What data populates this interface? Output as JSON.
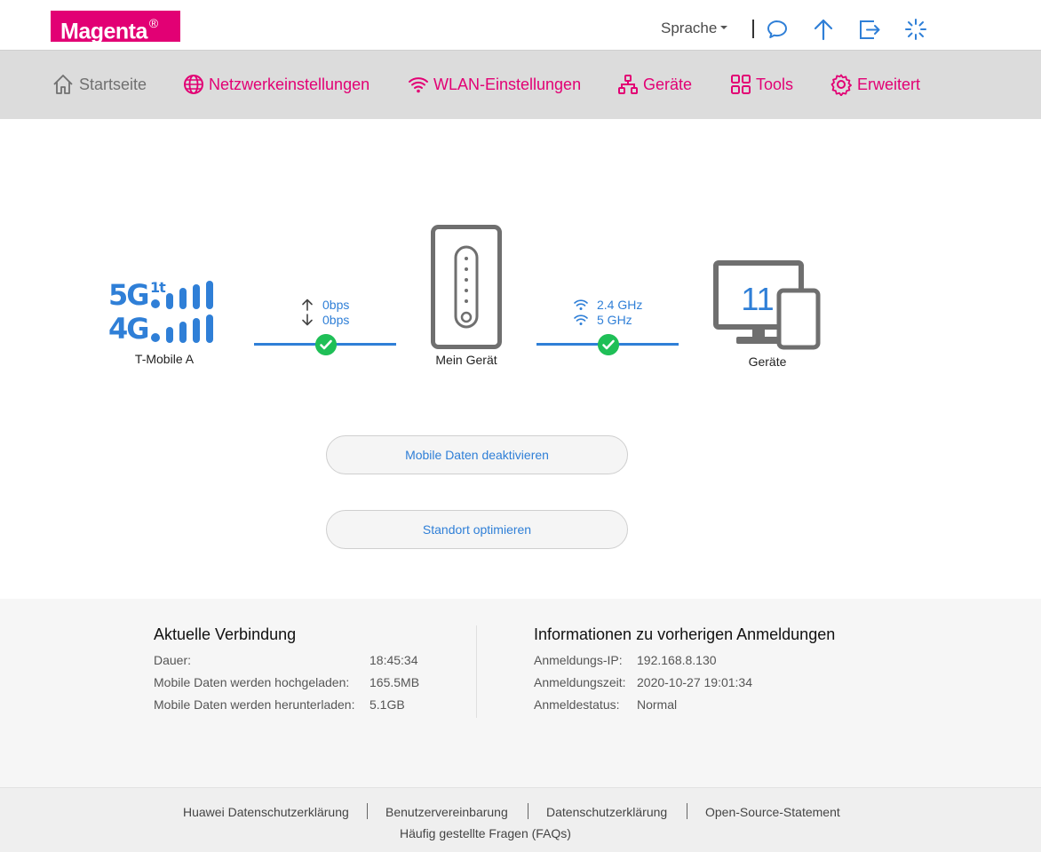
{
  "header": {
    "logo_text": "Magenta",
    "logo_mark": "®",
    "language_label": "Sprache",
    "icons": [
      "chat-icon",
      "upload-icon",
      "logout-icon",
      "loading-icon"
    ]
  },
  "nav": {
    "items": [
      {
        "label": "Startseite",
        "icon": "home-icon"
      },
      {
        "label": "Netzwerkeinstellungen",
        "icon": "globe-icon"
      },
      {
        "label": "WLAN-Einstellungen",
        "icon": "wifi-icon"
      },
      {
        "label": "Geräte",
        "icon": "network-tree-icon"
      },
      {
        "label": "Tools",
        "icon": "grid-icon"
      },
      {
        "label": "Erweitert",
        "icon": "gear-icon"
      }
    ]
  },
  "diagram": {
    "network": {
      "badge_top": "5G",
      "badge_top_sup": "1t",
      "badge_bottom": "4G",
      "provider": "T-Mobile A"
    },
    "traffic": {
      "upload": "0bps",
      "download": "0bps"
    },
    "router_label": "Mein Gerät",
    "wifi": {
      "band1": "2.4 GHz",
      "band2": "5 GHz"
    },
    "devices": {
      "count": "11",
      "label": "Geräte"
    }
  },
  "actions": {
    "disable_mobile_data": "Mobile Daten deaktivieren",
    "optimize_location": "Standort optimieren"
  },
  "current_connection": {
    "title": "Aktuelle Verbindung",
    "rows": [
      {
        "label": "Dauer:",
        "value": "18:45:34"
      },
      {
        "label": "Mobile Daten werden hochgeladen:",
        "value": "165.5MB"
      },
      {
        "label": "Mobile Daten werden herunterladen:",
        "value": "5.1GB"
      }
    ]
  },
  "previous_logins": {
    "title": "Informationen zu vorherigen Anmeldungen",
    "rows": [
      {
        "label": "Anmeldungs-IP:",
        "value": "192.168.8.130"
      },
      {
        "label": "Anmeldungszeit:",
        "value": "2020-10-27 19:01:34"
      },
      {
        "label": "Anmeldestatus:",
        "value": "Normal"
      }
    ]
  },
  "footer": {
    "links": [
      "Huawei Datenschutzerklärung",
      "Benutzervereinbarung",
      "Datenschutzerklärung",
      "Open-Source-Statement"
    ],
    "faq": "Häufig gestellte Fragen (FAQs)"
  },
  "colors": {
    "brand": "#e20074",
    "accent_blue": "#2f7fd7",
    "success": "#1fbf57",
    "nav_bg": "#dcdcdc"
  }
}
